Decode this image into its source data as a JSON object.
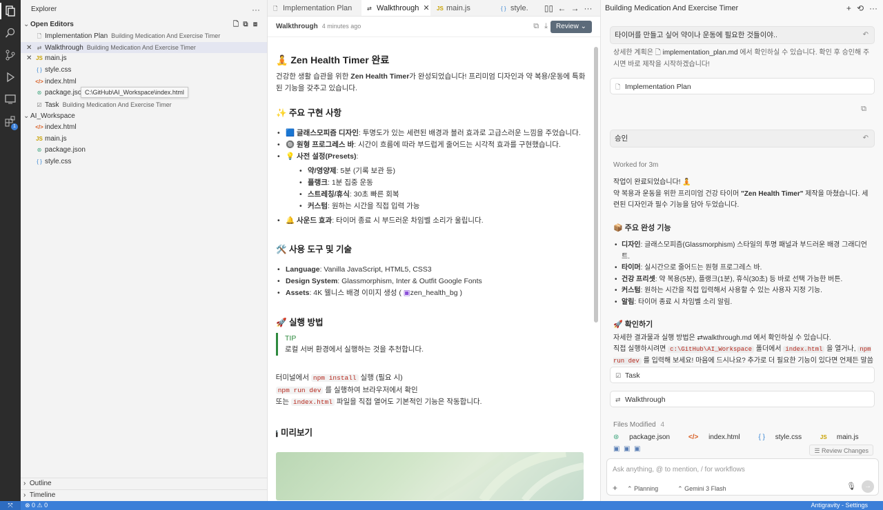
{
  "explorer": {
    "title": "Explorer",
    "open_editors_label": "Open Editors",
    "workspace_label": "AI_Workspace",
    "outline_label": "Outline",
    "timeline_label": "Timeline",
    "open_editors": [
      {
        "name": "Implementation Plan",
        "desc": "Building Medication And Exercise Timer",
        "icon": "doc",
        "close": false
      },
      {
        "name": "Walkthrough",
        "desc": "Building Medication And Exercise Timer",
        "icon": "doc",
        "close": true
      },
      {
        "name": "main.js",
        "desc": "",
        "icon": "js",
        "close": true
      },
      {
        "name": "style.css",
        "desc": "",
        "icon": "css",
        "close": false
      },
      {
        "name": "index.html",
        "desc": "",
        "icon": "html",
        "close": false
      },
      {
        "name": "package.jso",
        "desc": "",
        "icon": "json",
        "close": false
      },
      {
        "name": "Task",
        "desc": "Building Medication And Exercise Timer",
        "icon": "task",
        "close": false
      }
    ],
    "workspace_files": [
      {
        "name": "index.html",
        "icon": "html"
      },
      {
        "name": "main.js",
        "icon": "js"
      },
      {
        "name": "package.json",
        "icon": "json"
      },
      {
        "name": "style.css",
        "icon": "css"
      }
    ],
    "tooltip": "C:\\GitHub\\AI_Workspace\\index.html"
  },
  "tabs": [
    {
      "label": "Implementation Plan",
      "icon": "doc"
    },
    {
      "label": "Walkthrough",
      "icon": "doc"
    },
    {
      "label": "main.js",
      "icon": "JS"
    },
    {
      "label": "style.",
      "icon": "{ }"
    }
  ],
  "doc_header": {
    "title": "Walkthrough",
    "time": "4 minutes ago",
    "review": "Review"
  },
  "doc": {
    "h1": "🧘 Zen Health Timer 완료",
    "intro_1": "건강한 생활 습관을 위한 ",
    "intro_bold": "Zen Health Timer",
    "intro_2": "가 완성되었습니다! 프리미엄 디자인과 약 복용/운동에 특화된 기능을 갖추고 있습니다.",
    "h_features": "✨ 주요 구현 사항",
    "f1_b": "글래스모피즘 디자인",
    "f1_t": ": 투명도가 있는 세련된 배경과 블러 효과로 고급스러운 느낌을 주었습니다.",
    "f2_b": "원형 프로그레스 바",
    "f2_t": ": 시간이 흐름에 따라 부드럽게 줄어드는 시각적 효과를 구현했습니다.",
    "f3_b": "사전 설정(Presets)",
    "f3_t": ":",
    "p1_b": "약/영양제",
    "p1_t": ": 5분 (기록 보관 등)",
    "p2_b": "플랭크",
    "p2_t": ": 1분 집중 운동",
    "p3_b": "스트레칭/휴식",
    "p3_t": ": 30초 빠른 회복",
    "p4_b": "커스텀",
    "p4_t": ": 원하는 시간을 직접 입력 가능",
    "f4_b": "사운드 효과",
    "f4_t": ": 타이머 종료 시 부드러운 차임벨 소리가 울립니다.",
    "h_tools": "🛠️ 사용 도구 및 기술",
    "t1_b": "Language",
    "t1_t": ": Vanilla JavaScript, HTML5, CSS3",
    "t2_b": "Design System",
    "t2_t": ": Glassmorphism, Inter & Outfit Google Fonts",
    "t3_b": "Assets",
    "t3_t": ": 4K 웰니스 배경 이미지 생성 (",
    "t3_link": "zen_health_bg",
    "t3_end": " )",
    "h_run": "🚀 실행 방법",
    "tip_label": "TIP",
    "tip_text": "로컬 서버 환경에서 실행하는 것을 추천합니다.",
    "s1_a": "1. 터미널에서 ",
    "s1_code": "npm install",
    "s1_b": " 실행 (필요 시)",
    "s2_a": "2. ",
    "s2_code": "npm run dev",
    "s2_b": " 를 실행하여 브라우저에서 확인",
    "s3_a": "3. 또는 ",
    "s3_code": "index.html",
    "s3_b": " 파일을 직접 열어도 기본적인 기능은 작동합니다.",
    "h_preview": "📷 미리보기"
  },
  "chat": {
    "title": "Building Medication And Exercise Timer",
    "user_msg_1": "타이머를 만들고 싶어 약이나 운동에 필요한 것들이야..",
    "plan_a": "상세한 계획은 ",
    "plan_file": "implementation_plan.md",
    "plan_b": " 에서 확인하실 수 있습니다. 확인 후 승인해 주시면 바로 제작을 시작하겠습니다!",
    "card_plan": "Implementation Plan",
    "user_msg_2": "승인",
    "worked": "Worked for 3m",
    "done_1": "작업이 완료되었습니다! 🧘",
    "done_2a": "약 복용과 운동을 위한 프리미엄 건강 타이머 ",
    "done_2b": "\"Zen Health Timer\"",
    "done_2c": " 제작을 마쳤습니다. 세련된 디자인과 필수 기능을 담아 두었습니다.",
    "h_main": "📦 주요 완성 기능",
    "m1_b": "디자인",
    "m1_t": ": 글래스모피즘(Glassmorphism) 스타일의 투명 패널과 부드러운 배경 그래디언트.",
    "m2_b": "타이머",
    "m2_t": ": 실시간으로 줄어드는 원형 프로그레스 바.",
    "m3_b": "건강 프리셋",
    "m3_t": ": 약 복용(5분), 플랭크(1분), 휴식(30초) 등 바로 선택 가능한 버튼.",
    "m4_b": "커스텀",
    "m4_t": ": 원하는 시간을 직접 입력해서 사용할 수 있는 사용자 지정 기능.",
    "m5_b": "알림",
    "m5_t": ": 타이머 종료 시 차임벨 소리 알림.",
    "h_check": "🚀 확인하기",
    "c1_a": "자세한 결과물과 실행 방법은 ",
    "c1_file": "walkthrough.md",
    "c1_b": " 에서 확인하실 수 있습니다.",
    "c2_a": "직접 실행하시려면 ",
    "c2_code1": "c:\\GitHub\\AI_Workspace",
    "c2_b": " 폴더에서 ",
    "c2_code2": "index.html",
    "c2_c": " 을 열거나, ",
    "c2_code3": "npm run dev",
    "c2_d": " 를 입력해 보세요! 마음에 드시나요? 추가로 더 필요한 기능이 있다면 언제든 말씀해 주세요.",
    "card_task": "Task",
    "card_walk": "Walkthrough",
    "files_label": "Files Modified",
    "files_count": "4",
    "files": [
      "package.json",
      "index.html",
      "style.css",
      "main.js"
    ],
    "review_changes": "Review Changes",
    "input_placeholder": "Ask anything, @ to mention, / for workflows",
    "mode": "Planning",
    "model": "Gemini 3 Flash"
  },
  "status": {
    "problems": "⊗ 0 ⚠ 0",
    "right": "Antigravity - Settings"
  }
}
